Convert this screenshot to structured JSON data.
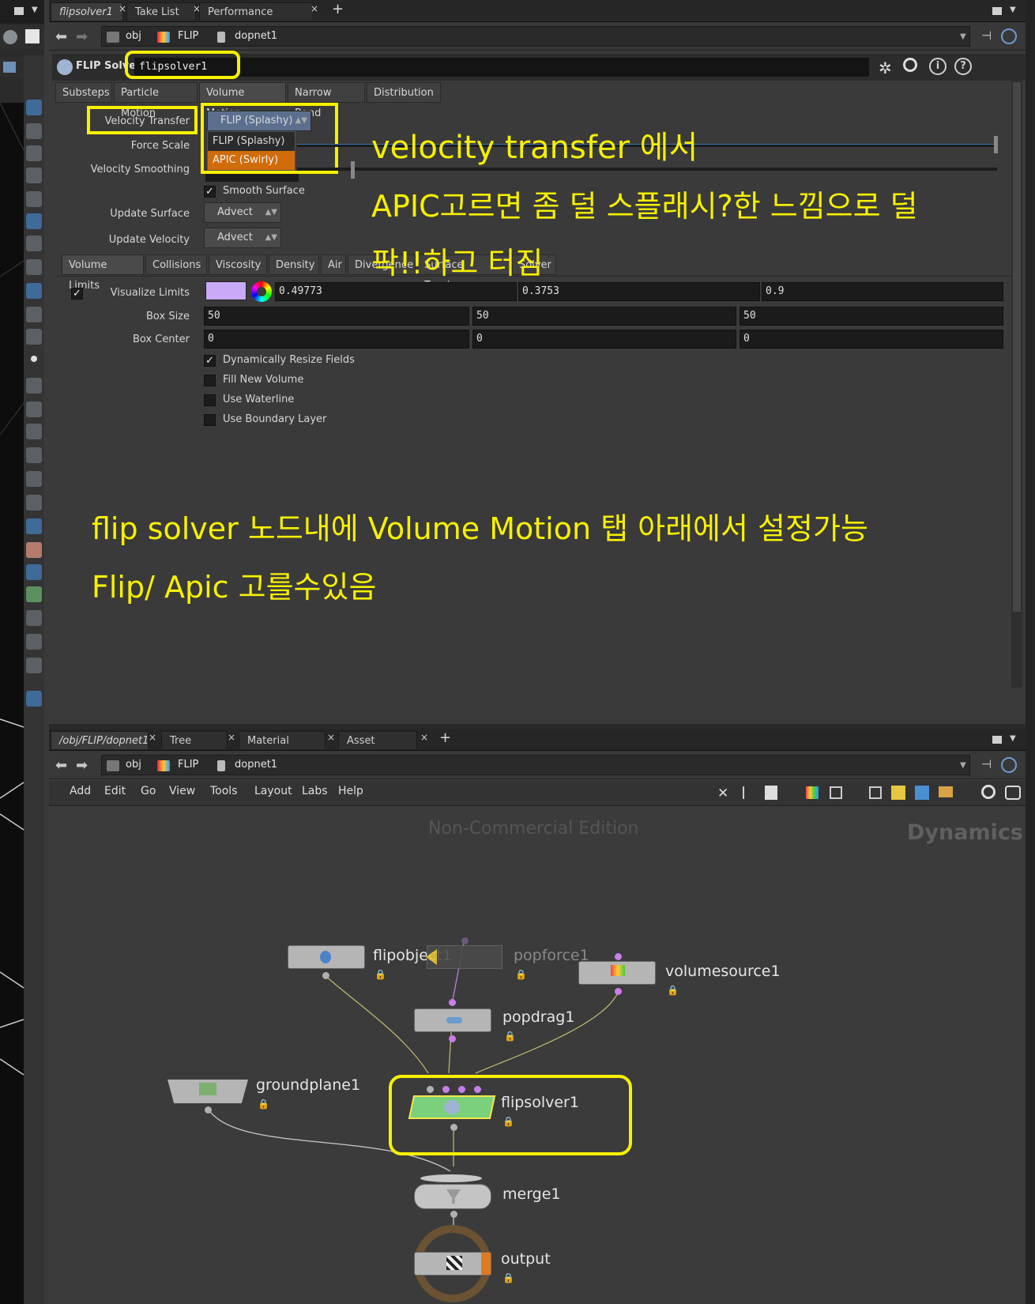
{
  "top_tabs": [
    {
      "label": "flipsolver1"
    },
    {
      "label": "Take List"
    },
    {
      "label": "Performance Monitor"
    }
  ],
  "top_path": {
    "crumbs": [
      "obj",
      "FLIP",
      "dopnet1"
    ]
  },
  "param_header": {
    "node_type": "FLIP Solver",
    "node_name": "flipsolver1"
  },
  "folder_tabs": [
    "Substeps",
    "Particle Motion",
    "Volume Motion",
    "Narrow Band",
    "Distribution"
  ],
  "volume_motion": {
    "velocity_transfer_label": "Velocity Transfer",
    "velocity_transfer_value": "FLIP (Splashy)",
    "velocity_transfer_options": [
      "FLIP (Splashy)",
      "APIC (Swirly)"
    ],
    "force_scale_label": "Force Scale",
    "velocity_smoothing_label": "Velocity Smoothing",
    "smooth_surface_label": "Smooth Surface",
    "update_surface_label": "Update Surface",
    "update_surface_value": "Advect",
    "update_velocity_label": "Update Velocity",
    "update_velocity_value": "Advect"
  },
  "sub_tabs": [
    "Volume Limits",
    "Collisions",
    "Viscosity",
    "Density",
    "Air",
    "Divergence",
    "Surface Tension",
    "Solver"
  ],
  "volume_limits": {
    "visualize_limits_label": "Visualize Limits",
    "visualize_color": [
      "0.49773",
      "0.3753",
      "0.9"
    ],
    "swatch_color": "#c8aaf8",
    "box_size_label": "Box Size",
    "box_size": [
      "50",
      "50",
      "50"
    ],
    "box_center_label": "Box Center",
    "box_center": [
      "0",
      "0",
      "0"
    ],
    "options": [
      "Dynamically Resize Fields",
      "Fill New Volume",
      "Use Waterline",
      "Use Boundary Layer"
    ],
    "options_checked": [
      true,
      false,
      false,
      false
    ]
  },
  "annotations": {
    "line1": "velocity transfer 에서",
    "line2": "APIC고르면 좀 덜 스플래시?한 느낌으로 덜",
    "line3": "팍!!하고 터짐",
    "line4": "flip solver 노드내에  Volume Motion 탭 아래에서 설정가능",
    "line5": "Flip/ Apic 고를수있음",
    "color": "#f7f000"
  },
  "bottom_tabs": [
    {
      "label": "/obj/FLIP/dopnet1"
    },
    {
      "label": "Tree View"
    },
    {
      "label": "Material Palette"
    },
    {
      "label": "Asset Browser"
    }
  ],
  "bottom_path": {
    "crumbs": [
      "obj",
      "FLIP",
      "dopnet1"
    ]
  },
  "net_menu": [
    "Add",
    "Edit",
    "Go",
    "View",
    "Tools",
    "Layout",
    "Labs",
    "Help"
  ],
  "network": {
    "watermark": "Non-Commercial Edition",
    "context_label": "Dynamics",
    "nodes": [
      "flipobject1",
      "popforce1",
      "volumesource1",
      "popdrag1",
      "groundplane1",
      "flipsolver1",
      "merge1",
      "output"
    ]
  }
}
